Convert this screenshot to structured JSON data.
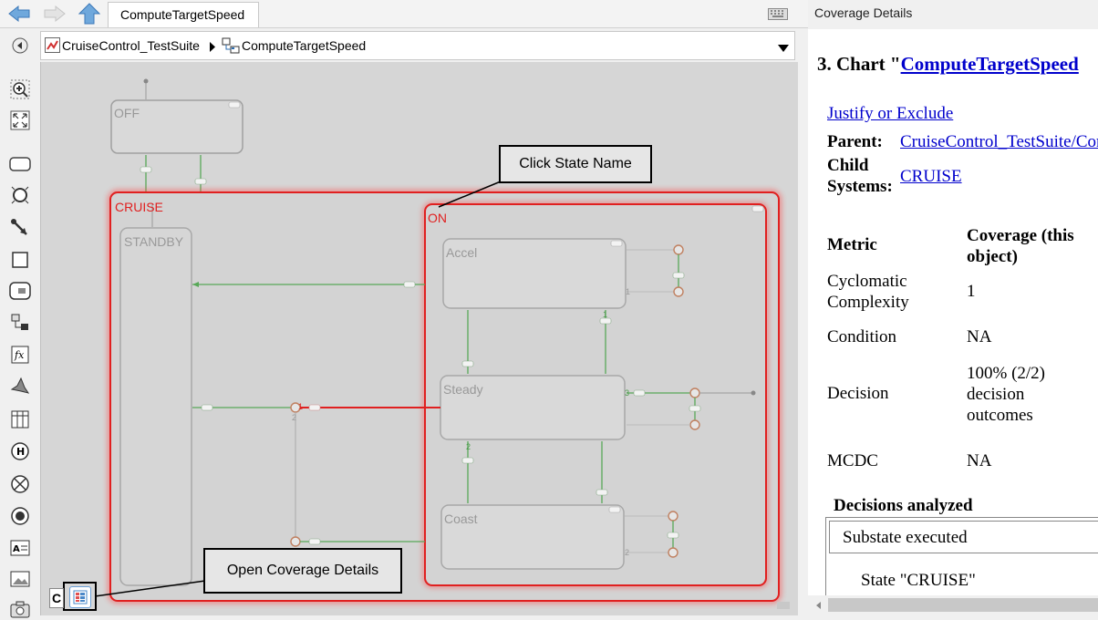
{
  "toolbar": {
    "tab_label": "ComputeTargetSpeed"
  },
  "breadcrumb": {
    "items": [
      "CruiseControl_TestSuite",
      "ComputeTargetSpeed"
    ]
  },
  "chart": {
    "states": {
      "off": "OFF",
      "cruise": "CRUISE",
      "standby": "STANDBY",
      "on": "ON",
      "accel": "Accel",
      "steady": "Steady",
      "coast": "Coast"
    },
    "transition_numbers": [
      "1",
      "2",
      "2",
      "1",
      "2",
      "3",
      "2",
      "2"
    ],
    "ellipsis": "..."
  },
  "callouts": {
    "state_name": "Click State Name",
    "coverage_details": "Open Coverage Details"
  },
  "bottom_badge": "C",
  "right_panel": {
    "title": "Coverage Details",
    "heading_prefix": "3. Chart \"",
    "heading_link": "ComputeTargetSpeed",
    "justify_link": "Justify or Exclude",
    "parent_label": "Parent:",
    "parent_link": "CruiseControl_TestSuite/ComputeTargetSpeed",
    "child_label_1": "Child",
    "child_label_2": "Systems:",
    "child_link": "CRUISE",
    "table_headers": [
      "Metric",
      "Coverage (this object)"
    ],
    "metrics": [
      {
        "name": "Cyclomatic Complexity",
        "value": "1"
      },
      {
        "name": "Condition",
        "value": "NA"
      },
      {
        "name": "Decision",
        "value": "100% (2/2) decision outcomes"
      },
      {
        "name": "MCDC",
        "value": "NA"
      }
    ],
    "decisions_heading": "Decisions analyzed",
    "decision_row": "Substate executed",
    "decision_state": "State \"CRUISE\""
  }
}
